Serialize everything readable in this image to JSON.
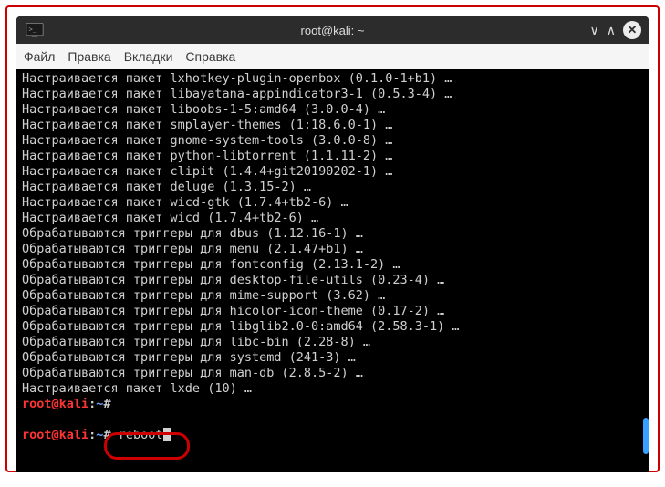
{
  "window": {
    "title": "root@kali: ~"
  },
  "menu": {
    "file": "Файл",
    "edit": "Правка",
    "tabs": "Вкладки",
    "help": "Справка"
  },
  "lines": [
    "Настраивается пакет lxhotkey-plugin-openbox (0.1.0-1+b1) …",
    "Настраивается пакет libayatana-appindicator3-1 (0.5.3-4) …",
    "Настраивается пакет liboobs-1-5:amd64 (3.0.0-4) …",
    "Настраивается пакет smplayer-themes (1:18.6.0-1) …",
    "Настраивается пакет gnome-system-tools (3.0.0-8) …",
    "Настраивается пакет python-libtorrent (1.1.11-2) …",
    "Настраивается пакет clipit (1.4.4+git20190202-1) …",
    "Настраивается пакет deluge (1.3.15-2) …",
    "Настраивается пакет wicd-gtk (1.7.4+tb2-6) …",
    "Настраивается пакет wicd (1.7.4+tb2-6) …",
    "Обрабатываются триггеры для dbus (1.12.16-1) …",
    "Обрабатываются триггеры для menu (2.1.47+b1) …",
    "Обрабатываются триггеры для fontconfig (2.13.1-2) …",
    "Обрабатываются триггеры для desktop-file-utils (0.23-4) …",
    "Обрабатываются триггеры для mime-support (3.62) …",
    "Обрабатываются триггеры для hicolor-icon-theme (0.17-2) …",
    "Обрабатываются триггеры для libglib2.0-0:amd64 (2.58.3-1) …",
    "Обрабатываются триггеры для libc-bin (2.28-8) …",
    "Обрабатываются триггеры для systemd (241-3) …",
    "Обрабатываются триггеры для man-db (2.8.5-2) …",
    "Настраивается пакет lxde (10) …"
  ],
  "prompt": {
    "userhost": "root@kali",
    "path": "~",
    "symbol": "#"
  },
  "previous_command": "",
  "current_command": "reboot"
}
